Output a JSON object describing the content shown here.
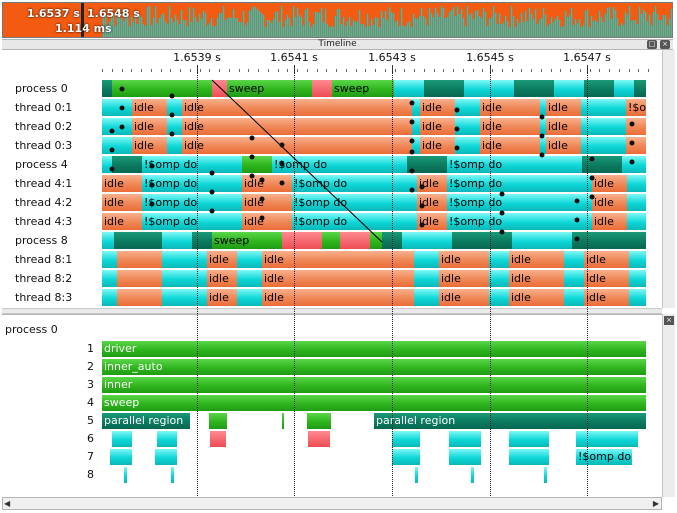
{
  "overview": {
    "label_a": "1.6537 s",
    "label_b": "1.6548 s",
    "label_c": "1.114 ms",
    "bg_color": "#f35a12",
    "fg_color": "#0dcfd0"
  },
  "timeline": {
    "title": "Timeline",
    "ticks": [
      "1.6539 s",
      "1.6541 s",
      "1.6543 s",
      "1.6545 s",
      "1.6547 s"
    ]
  },
  "rows": [
    {
      "label": "process 0",
      "segments": [
        [
          "dgreen",
          ""
        ],
        [
          "green",
          ""
        ],
        [
          "red",
          ""
        ],
        [
          "green",
          "sweep"
        ],
        [
          "red",
          ""
        ],
        [
          "green",
          "sweep"
        ],
        [
          "teal",
          ""
        ],
        [
          "dgreen",
          ""
        ],
        [
          "teal",
          ""
        ],
        [
          "dgreen",
          ""
        ],
        [
          "teal",
          ""
        ],
        [
          "dgreen",
          ""
        ],
        [
          "teal",
          ""
        ],
        [
          "dgreen",
          ""
        ]
      ]
    },
    {
      "label": "thread 0:1",
      "segments": [
        [
          "teal",
          ""
        ],
        [
          "orange",
          "idle"
        ],
        [
          "teal",
          ""
        ],
        [
          "orange",
          "idle"
        ],
        [
          "teal",
          ""
        ],
        [
          "orange",
          "idle"
        ],
        [
          "teal",
          ""
        ],
        [
          "orange",
          "idle"
        ],
        [
          "teal",
          ""
        ],
        [
          "orange",
          "idle"
        ],
        [
          "teal",
          ""
        ],
        [
          "orange",
          "!$omp do"
        ]
      ]
    },
    {
      "label": "thread 0:2",
      "segments": [
        [
          "teal",
          ""
        ],
        [
          "orange",
          "idle"
        ],
        [
          "teal",
          ""
        ],
        [
          "orange",
          "idle"
        ],
        [
          "teal",
          ""
        ],
        [
          "orange",
          "idle"
        ],
        [
          "teal",
          ""
        ],
        [
          "orange",
          "idle"
        ],
        [
          "teal",
          ""
        ],
        [
          "orange",
          "idle"
        ],
        [
          "teal",
          ""
        ],
        [
          "orange",
          ""
        ]
      ]
    },
    {
      "label": "thread 0:3",
      "segments": [
        [
          "teal",
          ""
        ],
        [
          "orange",
          "idle"
        ],
        [
          "teal",
          ""
        ],
        [
          "orange",
          "idle"
        ],
        [
          "teal",
          ""
        ],
        [
          "orange",
          "idle"
        ],
        [
          "teal",
          ""
        ],
        [
          "orange",
          "idle"
        ],
        [
          "teal",
          ""
        ],
        [
          "orange",
          "idle"
        ],
        [
          "teal",
          ""
        ],
        [
          "orange",
          ""
        ]
      ]
    },
    {
      "label": "process 4",
      "segments": [
        [
          "teal",
          ""
        ],
        [
          "dgreen",
          ""
        ],
        [
          "teal",
          "!$omp do"
        ],
        [
          "green",
          ""
        ],
        [
          "teal",
          "!$omp do"
        ],
        [
          "dgreen",
          ""
        ],
        [
          "teal",
          "!$omp do"
        ],
        [
          "dgreen",
          ""
        ],
        [
          "teal",
          ""
        ]
      ]
    },
    {
      "label": "thread 4:1",
      "segments": [
        [
          "orange",
          "idle"
        ],
        [
          "teal",
          "!$omp do"
        ],
        [
          "orange",
          "idle"
        ],
        [
          "teal",
          "!$omp do"
        ],
        [
          "orange",
          "idle"
        ],
        [
          "teal",
          "!$omp do"
        ],
        [
          "orange",
          "idle"
        ],
        [
          "teal",
          ""
        ]
      ]
    },
    {
      "label": "thread 4:2",
      "segments": [
        [
          "orange",
          "idle"
        ],
        [
          "teal",
          "!$omp do"
        ],
        [
          "orange",
          "idle"
        ],
        [
          "teal",
          "!$omp do"
        ],
        [
          "orange",
          "idle"
        ],
        [
          "teal",
          "!$omp do"
        ],
        [
          "orange",
          "idle"
        ],
        [
          "teal",
          ""
        ]
      ]
    },
    {
      "label": "thread 4:3",
      "segments": [
        [
          "orange",
          "idle"
        ],
        [
          "teal",
          "!$omp do"
        ],
        [
          "orange",
          "idle"
        ],
        [
          "teal",
          "!$omp do"
        ],
        [
          "orange",
          "idle"
        ],
        [
          "teal",
          "!$omp do"
        ],
        [
          "orange",
          "idle"
        ],
        [
          "teal",
          ""
        ]
      ]
    },
    {
      "label": "process 8",
      "segments": [
        [
          "teal",
          ""
        ],
        [
          "dgreen",
          ""
        ],
        [
          "teal",
          ""
        ],
        [
          "dgreen",
          ""
        ],
        [
          "green",
          "sweep"
        ],
        [
          "red",
          ""
        ],
        [
          "green",
          ""
        ],
        [
          "red",
          ""
        ],
        [
          "green",
          ""
        ],
        [
          "dgreen",
          ""
        ],
        [
          "teal",
          ""
        ],
        [
          "dgreen",
          ""
        ],
        [
          "teal",
          ""
        ],
        [
          "dgreen",
          ""
        ]
      ]
    },
    {
      "label": "thread 8:1",
      "segments": [
        [
          "teal",
          ""
        ],
        [
          "orange",
          ""
        ],
        [
          "teal",
          ""
        ],
        [
          "orange",
          "idle"
        ],
        [
          "teal",
          ""
        ],
        [
          "orange",
          "idle"
        ],
        [
          "teal",
          ""
        ],
        [
          "orange",
          "idle"
        ],
        [
          "teal",
          ""
        ],
        [
          "orange",
          "idle"
        ],
        [
          "teal",
          ""
        ],
        [
          "orange",
          "idle"
        ],
        [
          "teal",
          ""
        ]
      ]
    },
    {
      "label": "thread 8:2",
      "segments": [
        [
          "teal",
          ""
        ],
        [
          "orange",
          ""
        ],
        [
          "teal",
          ""
        ],
        [
          "orange",
          "idle"
        ],
        [
          "teal",
          ""
        ],
        [
          "orange",
          "idle"
        ],
        [
          "teal",
          ""
        ],
        [
          "orange",
          "idle"
        ],
        [
          "teal",
          ""
        ],
        [
          "orange",
          "idle"
        ],
        [
          "teal",
          ""
        ],
        [
          "orange",
          "idle"
        ],
        [
          "teal",
          ""
        ]
      ]
    },
    {
      "label": "thread 8:3",
      "segments": [
        [
          "teal",
          ""
        ],
        [
          "orange",
          ""
        ],
        [
          "teal",
          ""
        ],
        [
          "orange",
          "idle"
        ],
        [
          "teal",
          ""
        ],
        [
          "orange",
          "idle"
        ],
        [
          "teal",
          ""
        ],
        [
          "orange",
          "idle"
        ],
        [
          "teal",
          ""
        ],
        [
          "orange",
          "idle"
        ],
        [
          "teal",
          ""
        ],
        [
          "orange",
          "idle"
        ],
        [
          "teal",
          ""
        ]
      ]
    }
  ],
  "callstack": {
    "title": "process 0",
    "levels": [
      {
        "depth": "1",
        "segments": [
          [
            "green",
            "driver"
          ]
        ]
      },
      {
        "depth": "2",
        "segments": [
          [
            "green",
            "inner_auto"
          ]
        ]
      },
      {
        "depth": "3",
        "segments": [
          [
            "green",
            "inner"
          ]
        ]
      },
      {
        "depth": "4",
        "segments": [
          [
            "green",
            "sweep"
          ]
        ]
      },
      {
        "depth": "5",
        "segments": [
          [
            "dgreen",
            "parallel region"
          ],
          [
            "green",
            ""
          ],
          [
            "green",
            ""
          ],
          [
            "green",
            ""
          ],
          [
            "dgreen",
            "parallel region"
          ]
        ]
      },
      {
        "depth": "6",
        "segments": [
          [
            "teal",
            ""
          ],
          [
            "teal",
            ""
          ],
          [
            "red",
            ""
          ],
          [
            "red",
            ""
          ],
          [
            "teal",
            ""
          ],
          [
            "teal",
            ""
          ],
          [
            "teal",
            ""
          ],
          [
            "teal",
            ""
          ]
        ]
      },
      {
        "depth": "7",
        "segments": [
          [
            "teal",
            ""
          ],
          [
            "teal",
            ""
          ],
          [
            "teal",
            ""
          ],
          [
            "teal",
            ""
          ],
          [
            "teal",
            ""
          ],
          [
            "teal",
            "!$omp do"
          ]
        ]
      },
      {
        "depth": "8",
        "segments": [
          [
            "teal",
            ""
          ],
          [
            "teal",
            ""
          ],
          [
            "teal",
            ""
          ],
          [
            "teal",
            ""
          ],
          [
            "teal",
            ""
          ]
        ]
      }
    ]
  }
}
